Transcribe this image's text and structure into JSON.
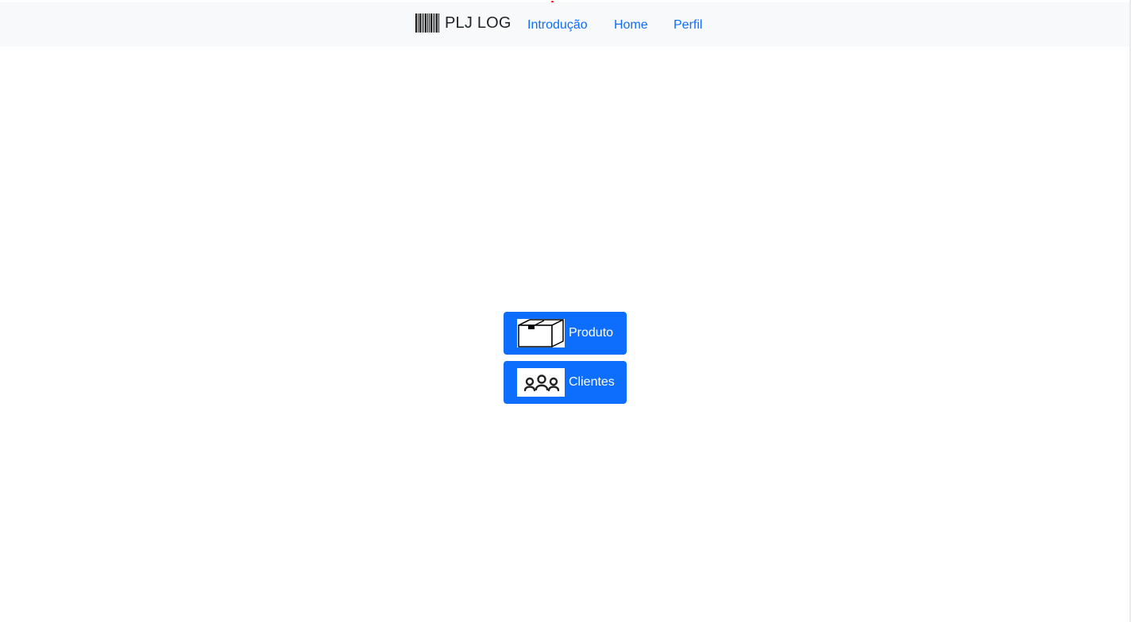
{
  "navbar": {
    "brand": {
      "icon": "barcode-icon",
      "title": "PLJ LOG"
    },
    "links": [
      {
        "label": "Introdução"
      },
      {
        "label": "Home"
      },
      {
        "label": "Perfil"
      }
    ]
  },
  "main": {
    "buttons": [
      {
        "label": "Produto",
        "icon": "box-icon"
      },
      {
        "label": "Clientes",
        "icon": "people-icon"
      }
    ]
  },
  "colors": {
    "navbar_bg": "#f8f9fa",
    "link": "#0d6efd",
    "button_bg": "#0d6efd",
    "button_text": "#ffffff",
    "brand_text": "#212529"
  }
}
